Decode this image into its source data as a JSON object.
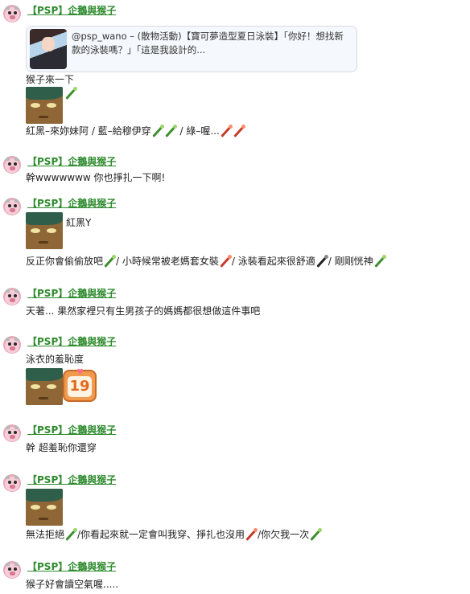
{
  "author_name": "【PSP】企鵝與猴子",
  "shared_card": {
    "text": "@psp_wano – (散物活動)【寶可夢造型夏日泳裝】「你好！想找新款的泳裝嗎？」「這是我設計的..."
  },
  "posts": [
    {
      "lines": [
        "猴子來一下",
        "紅黑–來妳妹阿 / 藍–給穆伊穿",
        " / 綠–喔..."
      ]
    },
    {
      "lines": [
        "幹wwwwwww 你也掙扎一下啊!"
      ]
    },
    {
      "sticker_caption": "紅黑Y",
      "lines": [
        "反正你會偷偷放吧",
        "/ 小時候常被老媽套女裝",
        "/ 泳裝看起來很舒適",
        "/ 剛剛恍神"
      ]
    },
    {
      "lines": [
        "天著... 果然家裡只有生男孩子的媽媽都很想做這件事吧"
      ]
    },
    {
      "lines": [
        "泳衣的羞恥度"
      ],
      "badge_number": "19"
    },
    {
      "lines": [
        "幹 超羞恥你還穿"
      ]
    },
    {
      "lines": [
        "無法拒絕",
        "/你看起來就一定會叫我穿、掙扎也沒用",
        "/你欠我一次"
      ]
    },
    {
      "lines": [
        "猴子好會讀空氣喔....."
      ]
    }
  ],
  "colors": {
    "author_green": "#2e8b2e",
    "card_border": "#d6dbe3"
  }
}
